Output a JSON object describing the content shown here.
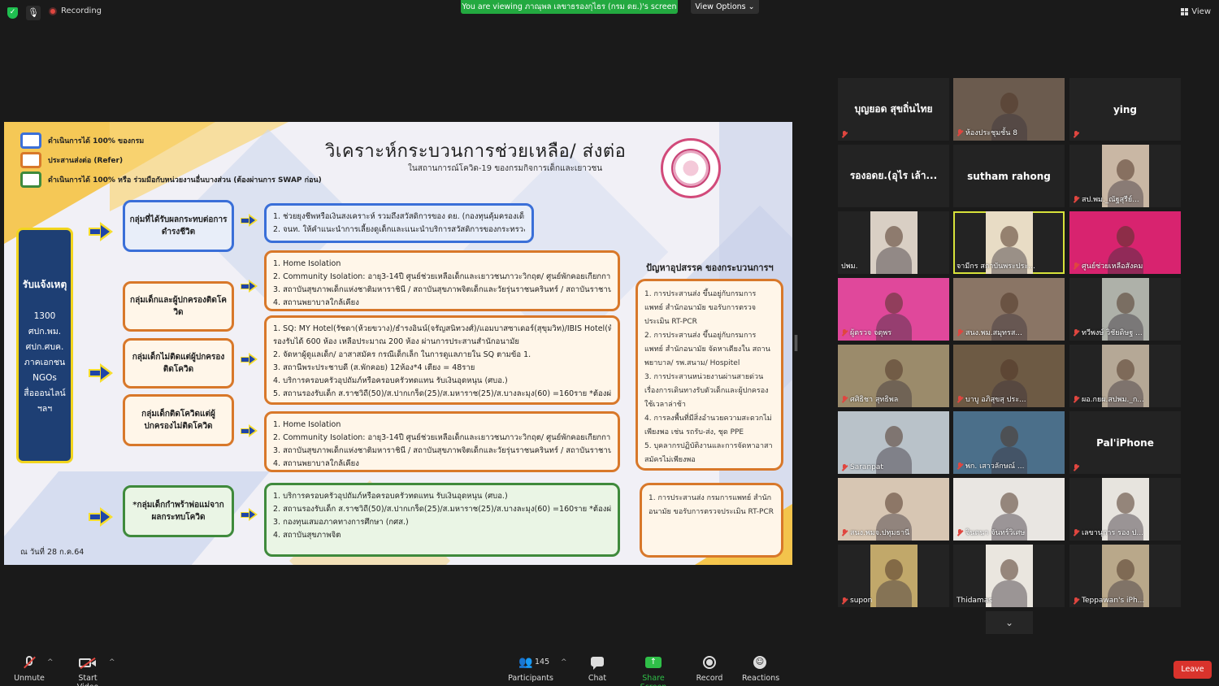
{
  "topbar": {
    "recording_label": "Recording",
    "viewing_banner": "You are viewing ภาณุพล เลขาธรองกุไธร (กรม ดย.)'s screen",
    "view_options": "View Options",
    "view_label": "View"
  },
  "slide": {
    "title": "วิเคราะห์กระบวนการช่วยเหลือ/ ส่งต่อ",
    "subtitle": "ในสถานการณ์โควิด-19 ของกรมกิจการเด็กและเยาวชน",
    "legend": [
      {
        "label": "ดำเนินการได้ 100% ของกรม",
        "color": "#3a6fd8"
      },
      {
        "label": "ประสานส่งต่อ (Refer)",
        "color": "#d8782a"
      },
      {
        "label": "ดำเนินการได้ 100% หรือ ร่วมมือกับหน่วยงานอื่นบางส่วน (ต้องผ่านการ SWAP ก่อน)",
        "color": "#3f8a3c"
      }
    ],
    "receive": {
      "title": "รับแจ้งเหตุ",
      "channels": [
        "1300",
        "ศปก.พม.",
        "ศปก.ศบค.",
        "ภาคเอกชน",
        "NGOs",
        "สื่อออนไลน์",
        "ฯลฯ"
      ]
    },
    "groups": [
      "กลุ่มที่ได้รับผลกระทบต่อการดำรงชีวิต",
      "กลุ่มเด็กและผู้ปกครองติดโควิด",
      "กลุ่มเด็กไม่ติดแต่ผู้ปกครองติดโควิด",
      "กลุ่มเด็กติดโควิดแต่ผู้ปกครองไม่ติดโควิด",
      "*กลุ่มเด็กกำพร้าพ่อแม่จากผลกระทบโควิด"
    ],
    "actions1": [
      "1. ช่วยยุงชีพหรือเงินสงเคราะห์ รวมถึงสวัสดิการของ ดย. (กองทุนคุ้มครองเด็ก)",
      "2. จนท. ให้คำแนะนำการเลี้ยงดูเด็กและแนะนำบริการสวัสดิการของกระทรวง พม."
    ],
    "actions2": [
      "1. Home Isolation",
      "2. Community Isolation: อายุ3-14ปี ศูนย์ช่วยเหลือเด็กและเยาวชนภาวะวิกฤต/ ศูนย์พักคอยเกียกกาย (กคส.)",
      "3. สถาบันสุขภาพเด็กแห่งชาติมหาราชินี / สถาบันสุขภาพจิตเด็กและวัยรุ่นราชนครินทร์ / สถาบันราชานุกูล",
      "4. สถานพยาบาลใกล้เคียง"
    ],
    "actions3": [
      "1. SQ: MY Hotel(รัชดา(ห้วยขวาง)/ธำรงอินน์(จรัญสนิทวงศ์)/แอมบาสซาเดอร์(สุขุมวิท)/IBIS Hotel(ห้วยขวาง)",
      "   รองรับได้ 600 ห้อง เหลือประมาณ 200 ห้อง ผ่านการประสานสำนักอนามัย",
      "2. จัดหาผู้ดูแลเด็ก/ อาสาสมัคร กรณีเด็กเล็ก ในการดูแลภายใน SQ ตามข้อ 1.",
      "3. สถานีพระประชาบดี (ส.พักคอย) 12ห้อง*4 เตียง = 48ราย",
      "4. บริการครอบครัวอุปถัมภ์หรือครอบครัวทดแทน รับเงินอุดหนุน (ศบอ.)",
      "5. สถานรองรับเด็ก ส.ราชวิถี(50)/ส.ปากเกร็ด(25)/ส.มหาราช(25)/ส.บางละมุง(60) =160ราย  *ต้องผ่านกักตัว14วัน"
    ],
    "actions4": [
      "1. Home Isolation",
      "2. Community Isolation: อายุ3-14ปี ศูนย์ช่วยเหลือเด็กและเยาวชนภาวะวิกฤต/ ศูนย์พักคอยเกียกกาย (กคส.)",
      "3. สถาบันสุขภาพเด็กแห่งชาติมหาราชินี / สถาบันสุขภาพจิตเด็กและวัยรุ่นราชนครินทร์ / สถาบันราชานุกูล",
      "4. สถานพยาบาลใกล้เคียง"
    ],
    "actions5": [
      "1. บริการครอบครัวอุปถัมภ์หรือครอบครัวทดแทน รับเงินอุดหนุน (ศบอ.)",
      "2. สถานรองรับเด็ก ส.ราชวิถี(50)/ส.ปากเกร็ด(25)/ส.มหาราช(25)/ส.บางละมุง(60) =160ราย  *ต้องผ่านกักตัว14วัน",
      "3. กองทุนเสมอภาคทางการศึกษา (กศส.)",
      "4. สถาบันสุขภาพจิต"
    ],
    "problems_title": "ปัญหาอุปสรรค ของกระบวนการฯ",
    "problems": [
      "1. การประสานส่ง ขึ้นอยู่กับกรมการแพทย์ สำนักอนามัย ขอรับการตรวจประเมิน RT-PCR",
      "2. การประสานส่ง ขึ้นอยู่กับกรมการแพทย์ สำนักอนามัย จัดหาเตียงใน สถานพยาบาล/ รพ.สนาม/ Hospitel",
      "3. การประสานหน่วยงานผ่านสายด่วน เรื่องการเดินทางรับตัวเด็กและผู้ปกครอง ใช้เวลาล่าช้า",
      "4. การลงพื้นที่มีสิ่งอำนวยความสะดวกไม่เพียงพอ เช่น รถรับ-ส่ง, ชุด PPE",
      "5. บุคลากรปฏิบัติงานและการจัดหาอาสาสมัครไม่เพียงพอ"
    ],
    "problem_bottom": "1. การประสานส่ง กรมการแพทย์ สำนักอนามัย ขอรับการตรวจประเมิน RT-PCR",
    "date_note": "ณ วันที่ 28 ก.ค.64"
  },
  "participants": [
    {
      "name": "บุญยอด สุขถิ่นไทย",
      "video": false,
      "muted": true
    },
    {
      "name": "ห้องประชุมชั้น 8",
      "video": true,
      "muted": true,
      "bg": "#6b5b4e"
    },
    {
      "name": "ying",
      "video": false,
      "muted": true
    },
    {
      "name": "รองอดย.(อุไร เล้า...",
      "video": false,
      "muted": false
    },
    {
      "name": "sutham rahong",
      "video": false,
      "muted": false
    },
    {
      "name": "สป.พม._ณัฐสุรีย์...",
      "video": true,
      "muted": true,
      "bg": "#c9b7a4"
    },
    {
      "name": "ปพม.",
      "video": true,
      "muted": false,
      "bg": "#d9cfc4"
    },
    {
      "name": "จามีกร สถาบันพระประ...",
      "video": true,
      "muted": false,
      "bg": "#e8dcc5",
      "speaking": true
    },
    {
      "name": "ศูนย์ช่วยเหลือสังคม",
      "video": true,
      "muted": true,
      "bg": "#d8236f"
    },
    {
      "name": "ผู้ตรวจ จตุพร",
      "video": true,
      "muted": true,
      "bg": "#e0489b"
    },
    {
      "name": "สนง.พม.สมุทรส...",
      "video": true,
      "muted": true,
      "bg": "#8a7565"
    },
    {
      "name": "ทวีพงษ์ วิชัยดิษฐ ...",
      "video": true,
      "muted": true,
      "bg": "#aeb1a9"
    },
    {
      "name": "ศศิธิชา สุทธิพล",
      "video": true,
      "muted": true,
      "bg": "#9b8b6b"
    },
    {
      "name": "บาบู อภิสุขสุ ประ...",
      "video": true,
      "muted": true,
      "bg": "#6d5a44"
    },
    {
      "name": "ผอ.กยผ.สปพม._ก...",
      "video": true,
      "muted": true,
      "bg": "#b5a896"
    },
    {
      "name": "Saranpat",
      "video": true,
      "muted": true,
      "bg": "#b9c2c9"
    },
    {
      "name": "พก. เสาวลักษณ์ ...",
      "video": true,
      "muted": true,
      "bg": "#4b6f8a"
    },
    {
      "name": "Pal'iPhone",
      "video": false,
      "muted": true
    },
    {
      "name": "สนง.พมจ.ปทุมธานี",
      "video": true,
      "muted": true,
      "bg": "#d7c6b3"
    },
    {
      "name": "จินตนา จันทร์วิเศษ",
      "video": true,
      "muted": true,
      "bg": "#e9e6e2"
    },
    {
      "name": "เลขานุการ รอง ป...",
      "video": true,
      "muted": true,
      "bg": "#e7e4de"
    },
    {
      "name": "supon",
      "video": true,
      "muted": true,
      "bg": "#c1a86a"
    },
    {
      "name": "Thidamas",
      "video": true,
      "muted": false,
      "bg": "#eae6df"
    },
    {
      "name": "Teppawan's iPh...",
      "video": true,
      "muted": true,
      "bg": "#b9a88a"
    }
  ],
  "toolbar": {
    "unmute": "Unmute",
    "start_video": "Start Video",
    "participants": "Participants",
    "participant_count": "145",
    "chat": "Chat",
    "share_screen": "Share Screen",
    "record": "Record",
    "reactions": "Reactions",
    "leave": "Leave"
  }
}
